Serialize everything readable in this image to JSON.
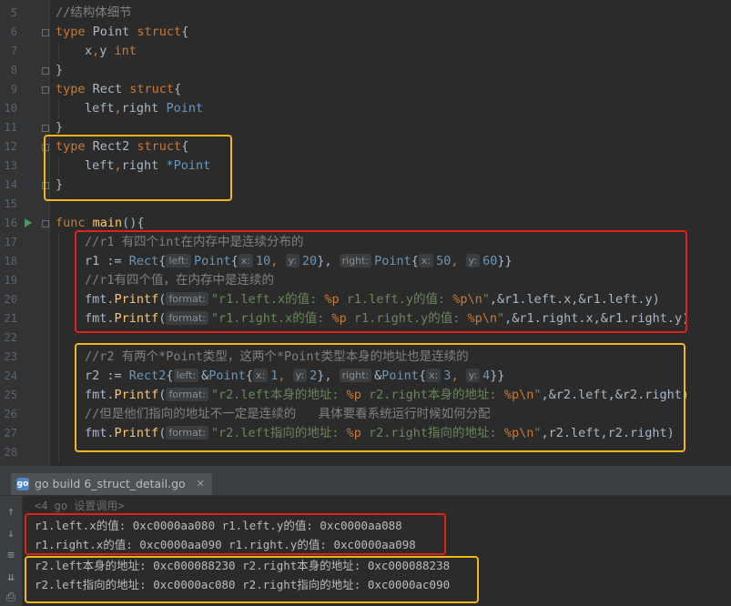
{
  "editor": {
    "line_numbers": [
      "5",
      "6",
      "7",
      "8",
      "9",
      "10",
      "11",
      "12",
      "13",
      "14",
      "15",
      "16",
      "17",
      "18",
      "19",
      "20",
      "21",
      "22",
      "23",
      "24",
      "25",
      "26",
      "27",
      "28"
    ],
    "lines": {
      "l5": [
        "//结构体细节"
      ],
      "l6": [
        "type",
        " Point ",
        "struct",
        "{"
      ],
      "l7": [
        "x",
        ",",
        "y ",
        "int"
      ],
      "l8": [
        "}"
      ],
      "l9": [
        "type",
        " Rect ",
        "struct",
        "{"
      ],
      "l10": [
        "left",
        ",",
        "right ",
        "Point"
      ],
      "l11": [
        "}"
      ],
      "l12": [
        "type",
        " Rect2 ",
        "struct",
        "{"
      ],
      "l13": [
        "left",
        ",",
        "right ",
        "*Point"
      ],
      "l14": [
        "}"
      ],
      "l16": [
        "func",
        " ",
        "main",
        "(){"
      ],
      "l17": [
        "//r1 有四个int在内存中是连续分布的"
      ],
      "l18": [
        "r1 := ",
        "Rect",
        "{",
        "left:",
        "Point",
        "{",
        "x:",
        "10",
        ", ",
        "y:",
        "20",
        "}, ",
        "right:",
        "Point",
        "{",
        "x:",
        "50",
        ", ",
        "y:",
        "60",
        "}}"
      ],
      "l19": [
        "//r1有四个值，在内存中是连续的"
      ],
      "l20": [
        "fmt.",
        "Printf",
        "(",
        "format:",
        "\"r1.left.x的值: ",
        "%p",
        " r1.left.y的值: ",
        "%p\\n",
        "\"",
        ",&r1.left.x,&r1.left.y)"
      ],
      "l21": [
        "fmt.",
        "Printf",
        "(",
        "format:",
        "\"r1.right.x的值: ",
        "%p",
        " r1.right.y的值: ",
        "%p\\n",
        "\"",
        ",&r1.right.x,&r1.right.y)"
      ],
      "l23": [
        "//r2 有两个*Point类型，这两个*Point类型本身的地址也是连续的"
      ],
      "l24": [
        "r2 := ",
        "Rect2",
        "{",
        "left:",
        "&",
        "Point",
        "{",
        "x:",
        "1",
        ", ",
        "y:",
        "2",
        "}, ",
        "right:",
        "&",
        "Point",
        "{",
        "x:",
        "3",
        ", ",
        "y:",
        "4",
        "}}"
      ],
      "l25": [
        "fmt.",
        "Printf",
        "(",
        "format:",
        "\"r2.left本身的地址: ",
        "%p",
        " r2.right本身的地址: ",
        "%p\\n",
        "\"",
        ",&r2.left,&r2.right)"
      ],
      "l26": [
        "//但是他们指向的地址不一定是连续的   具体要看系统运行时候如何分配"
      ],
      "l27": [
        "fmt.",
        "Printf",
        "(",
        "format:",
        "\"r2.left指向的地址: ",
        "%p",
        " r2.right指向的地址: ",
        "%p\\n",
        "\"",
        ",r2.left,r2.right)"
      ]
    }
  },
  "run_panel": {
    "tab_icon": "go-file-icon",
    "tab_label": "go build 6_struct_detail.go",
    "close_label": "✕",
    "output": [
      "<4 go 设置调用>",
      "r1.left.x的值: 0xc0000aa080 r1.left.y的值: 0xc0000aa088",
      "r1.right.x的值: 0xc0000aa090 r1.right.y的值: 0xc0000aa098",
      "r2.left本身的地址: 0xc000088230 r2.right本身的地址: 0xc000088238",
      "r2.left指向的地址: 0xc0000ac080 r2.right指向的地址: 0xc0000ac090"
    ],
    "toolbar_icons": [
      "arrow-up-icon",
      "arrow-down-icon",
      "soft-wrap-icon",
      "scroll-to-end-icon",
      "print-icon"
    ]
  },
  "annotation_colors": {
    "red": "#e0201a",
    "yellow": "#f2b51a"
  }
}
